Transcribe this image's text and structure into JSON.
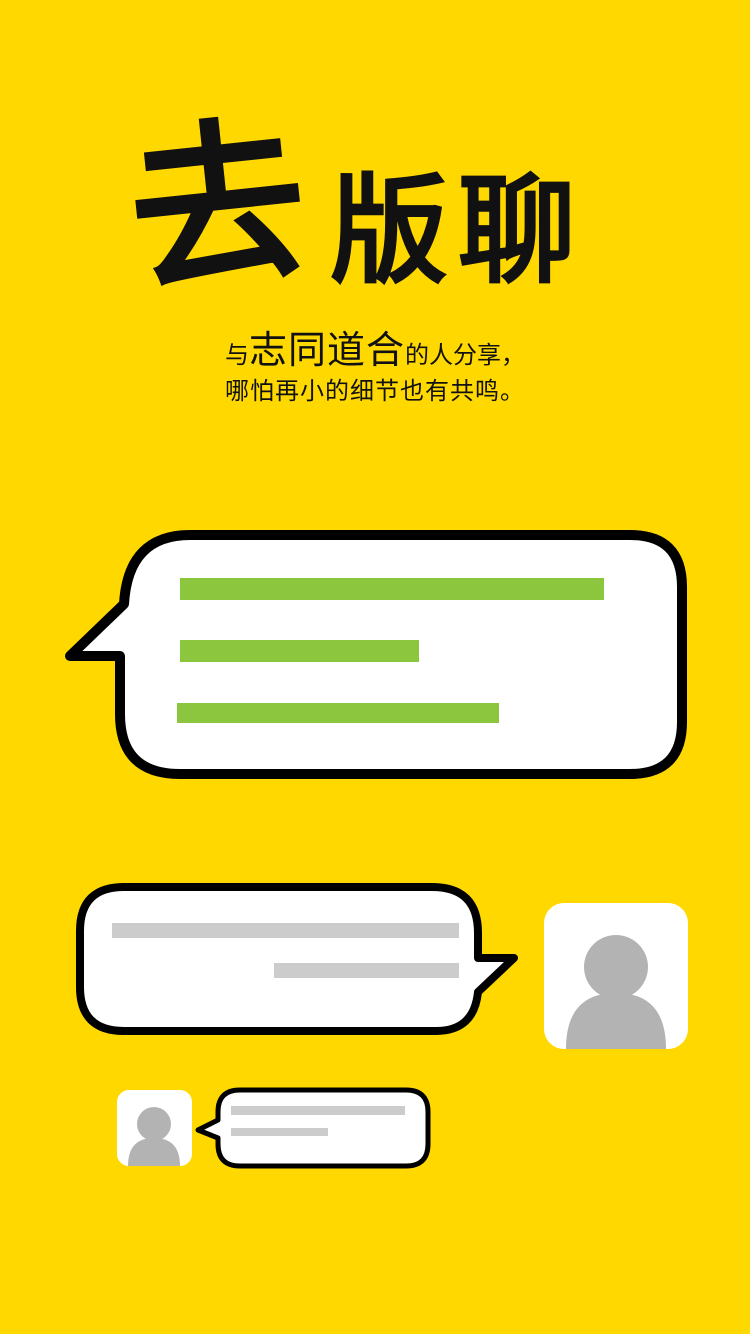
{
  "title": {
    "char1": "去",
    "char2": "版",
    "char3": "聊"
  },
  "slogan": {
    "line1_pre": "与",
    "line1_big": "志同道合",
    "line1_post": "的人分享，",
    "line2": "哪怕再小的细节也有共鸣。"
  },
  "colors": {
    "background": "#FFD800",
    "accent_green": "#8CC63F",
    "placeholder_gray": "#CCCCCC",
    "avatar_gray": "#B3B3B3",
    "outline": "#000000"
  },
  "icons": {
    "avatar_large": "user-avatar-icon",
    "avatar_small": "user-avatar-icon"
  }
}
